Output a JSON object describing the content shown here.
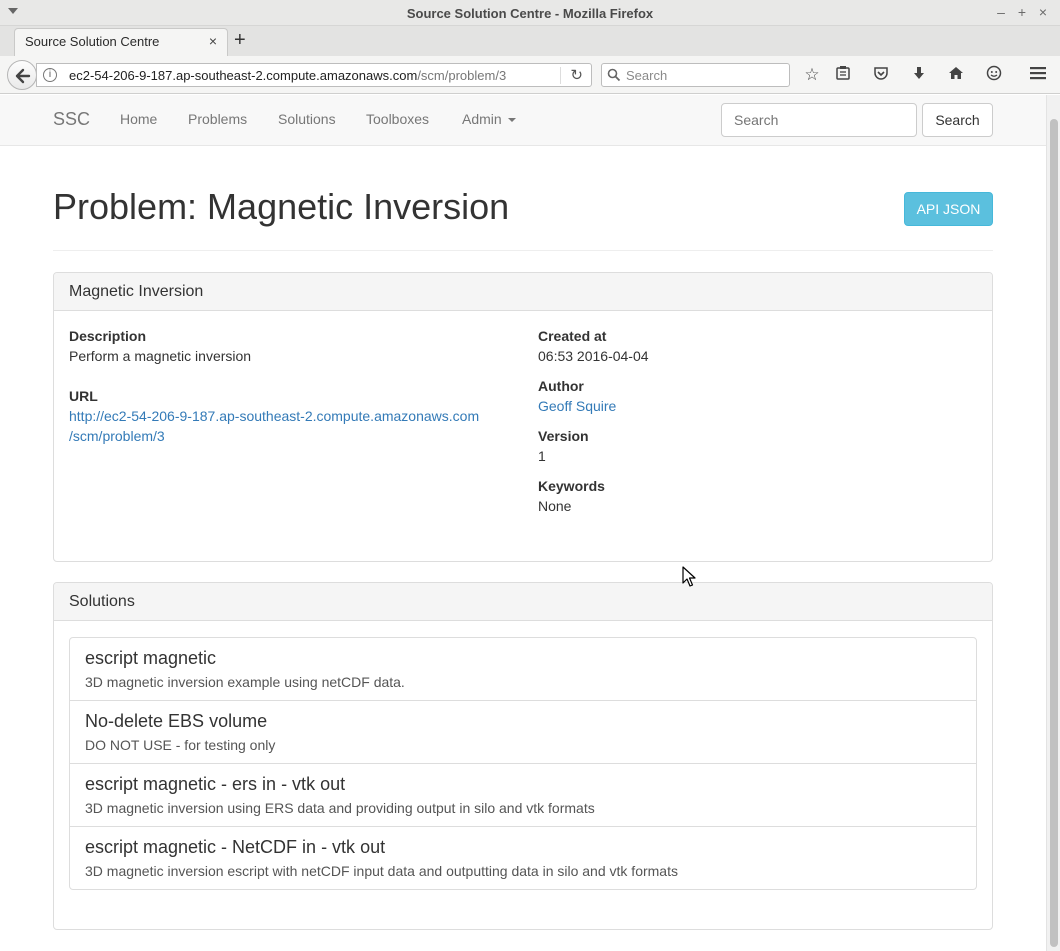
{
  "window": {
    "title": "Source Solution Centre - Mozilla Firefox",
    "minimize": "–",
    "maximize": "+",
    "close": "×"
  },
  "tab": {
    "title": "Source Solution Centre",
    "close": "×",
    "new_tab": "+"
  },
  "urlbar": {
    "host": "ec2-54-206-9-187.ap-southeast-2.compute.amazonaws.com",
    "path": "/scm/problem/3",
    "info_glyph": "i",
    "reload_glyph": "↻"
  },
  "browser_search": {
    "placeholder": "Search"
  },
  "toolbar_icons": [
    "star-icon",
    "reading-list-icon",
    "pocket-icon",
    "download-icon",
    "home-icon",
    "hello-icon",
    "menu-icon"
  ],
  "navbar": {
    "brand": "SSC",
    "links": [
      "Home",
      "Problems",
      "Solutions",
      "Toolboxes",
      "Admin"
    ],
    "search_placeholder": "Search",
    "search_button": "Search"
  },
  "header": {
    "title": "Problem: Magnetic Inversion",
    "api_button": "API JSON"
  },
  "details_panel": {
    "heading": "Magnetic Inversion",
    "description_label": "Description",
    "description": "Perform a magnetic inversion",
    "url_label": "URL",
    "url_line1": "http://ec2-54-206-9-187.ap-southeast-2.compute.amazonaws.com",
    "url_line2": "/scm/problem/3",
    "created_label": "Created at",
    "created": "06:53 2016-04-04",
    "author_label": "Author",
    "author": "Geoff Squire",
    "version_label": "Version",
    "version": "1",
    "keywords_label": "Keywords",
    "keywords": "None"
  },
  "solutions_panel": {
    "heading": "Solutions",
    "items": [
      {
        "title": "escript magnetic",
        "desc": "3D magnetic inversion example using netCDF data."
      },
      {
        "title": "No-delete EBS volume",
        "desc": "DO NOT USE - for testing only"
      },
      {
        "title": "escript magnetic - ers in - vtk out",
        "desc": "3D magnetic inversion using ERS data and providing output in silo and vtk formats"
      },
      {
        "title": "escript magnetic - NetCDF in - vtk out",
        "desc": "3D magnetic inversion escript with netCDF input data and outputting data in silo and vtk formats"
      }
    ]
  },
  "colors": {
    "link": "#337ab7",
    "info_button": "#5bc0de",
    "navbar_bg": "#f8f8f8",
    "panel_heading_bg": "#f5f5f5"
  }
}
